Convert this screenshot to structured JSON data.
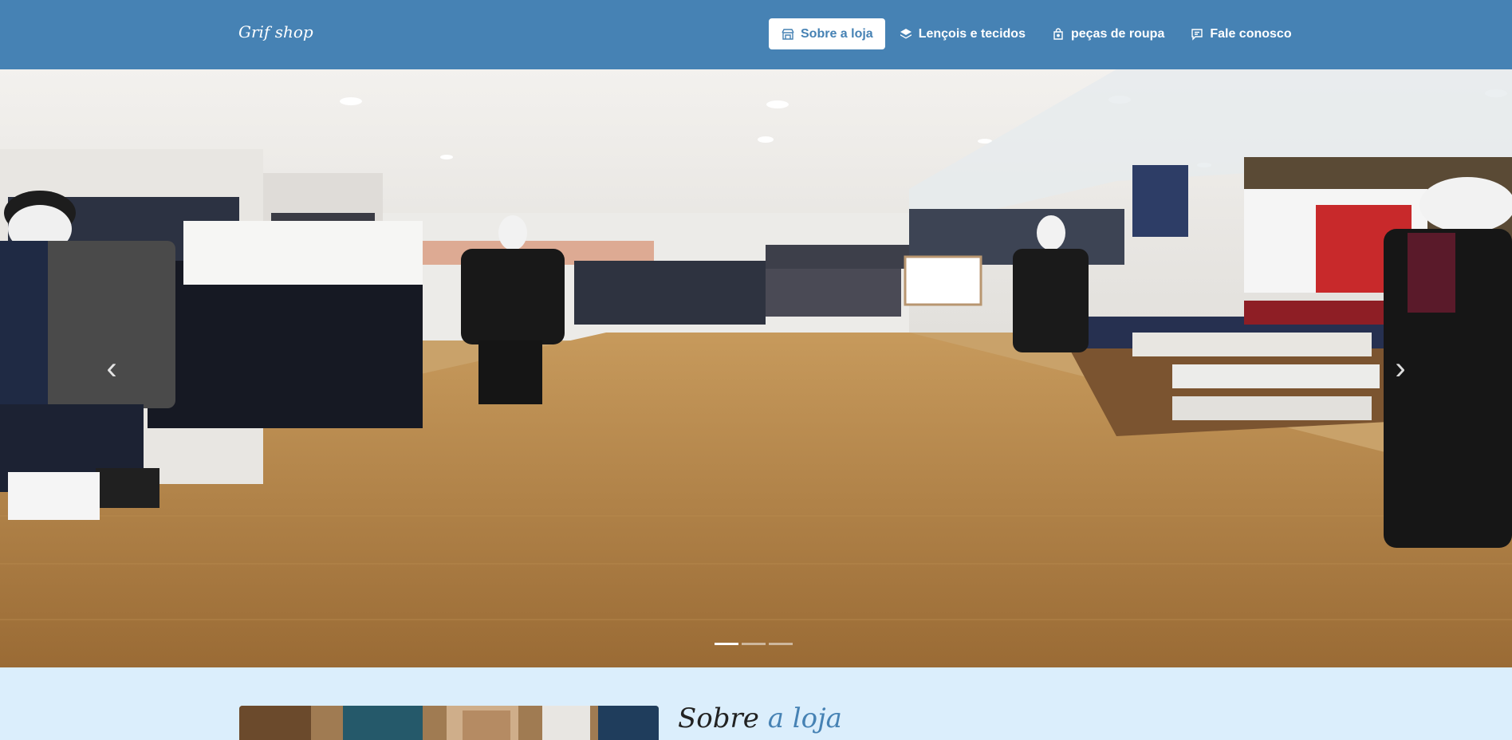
{
  "brand": {
    "name": "Grif shop"
  },
  "nav": {
    "items": [
      {
        "label": "Sobre a loja",
        "icon": "store-icon",
        "active": true
      },
      {
        "label": "Lençois e tecidos",
        "icon": "layers-icon",
        "active": false
      },
      {
        "label": "peças de roupa",
        "icon": "shopping-bag-icon",
        "active": false
      },
      {
        "label": "Fale conosco",
        "icon": "chat-icon",
        "active": false
      }
    ]
  },
  "carousel": {
    "prev_icon": "chevron-left-icon",
    "next_icon": "chevron-right-icon",
    "prev_glyph": "‹",
    "next_glyph": "›",
    "slide_count": 3,
    "active_index": 0
  },
  "about": {
    "title_part1": "Sobre",
    "title_part2": "a loja"
  },
  "colors": {
    "primary": "#4682b4",
    "section_bg": "#dbeefc",
    "white": "#ffffff"
  }
}
